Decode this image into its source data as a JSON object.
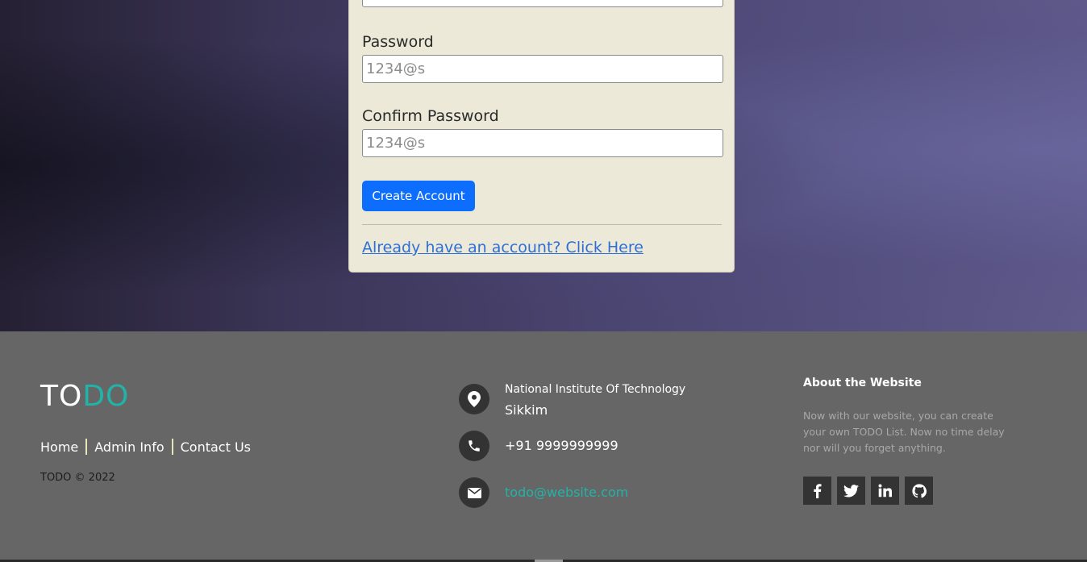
{
  "form": {
    "password_label": "Password",
    "password_placeholder": "1234@s",
    "confirm_label": "Confirm Password",
    "confirm_placeholder": "1234@s",
    "create_button": "Create Account",
    "login_link": "Already have an account? Click Here"
  },
  "footer": {
    "logo_part1": "TO",
    "logo_part2": "DO",
    "nav": [
      "Home",
      "Admin Info",
      "Contact Us"
    ],
    "copyright": "TODO © 2022",
    "address_line1": "National Institute Of Technology",
    "address_line2": "Sikkim",
    "phone": "+91 9999999999",
    "email": "todo@website.com",
    "about_title": "About the Website",
    "about_text": "Now with our website, you can create your own TODO List. Now no time delay nor will you forget anything."
  },
  "colors": {
    "accent": "#22b3a8",
    "primary_button": "#0d6efd",
    "card_bg": "#ece9d8",
    "footer_bg": "#666666"
  },
  "icons": {
    "address": "map-marker-icon",
    "phone": "phone-icon",
    "email": "envelope-icon",
    "social": [
      "facebook-icon",
      "twitter-icon",
      "linkedin-icon",
      "github-icon"
    ]
  }
}
